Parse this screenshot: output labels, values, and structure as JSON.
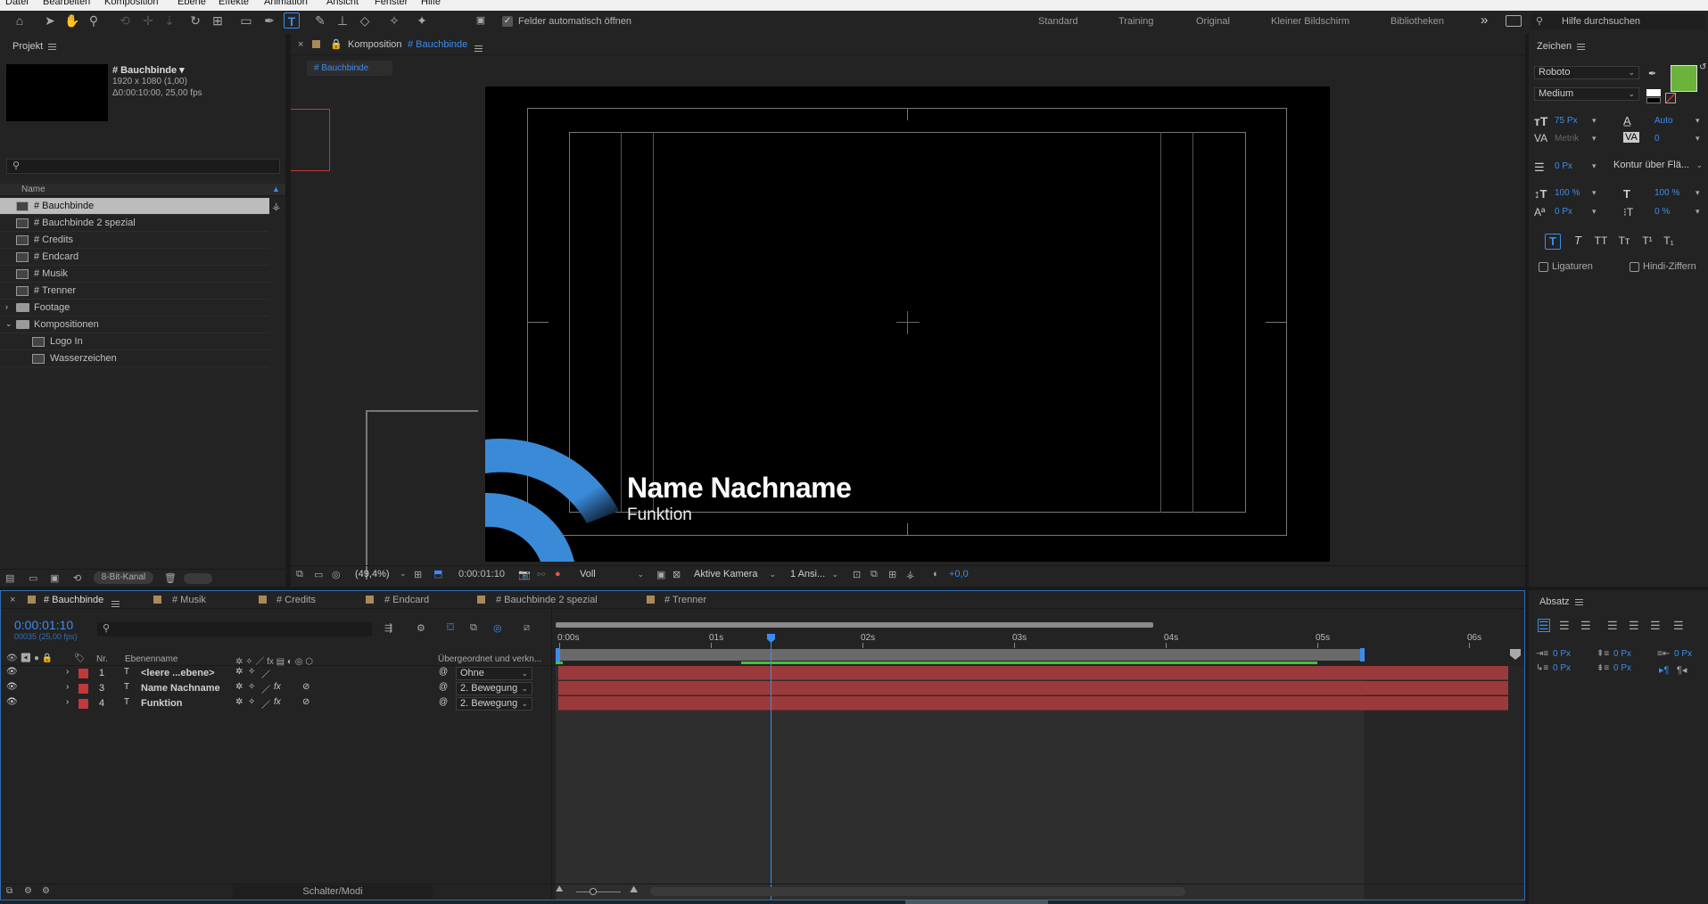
{
  "menu": [
    "Datei",
    "Bearbeiten",
    "Komposition",
    "Ebene",
    "Effekte",
    "Animation",
    "Ansicht",
    "Fenster",
    "Hilfe"
  ],
  "toolbar": {
    "auto_open_label": "Felder automatisch öffnen",
    "workspaces": [
      "Standard",
      "Training",
      "Original",
      "Kleiner Bildschirm",
      "Bibliotheken"
    ],
    "more": "»",
    "help_placeholder": "Hilfe durchsuchen"
  },
  "project": {
    "title": "Projekt",
    "selected_name": "# Bauchbinde ▾",
    "selected_info1": "1920 x 1080 (1,00)",
    "selected_info2": "Δ0:00:10:00, 25,00 fps",
    "column_name": "Name",
    "items": [
      {
        "label": "# Bauchbinde",
        "type": "comp",
        "indent": 0,
        "selected": true
      },
      {
        "label": "# Bauchbinde 2 spezial",
        "type": "comp",
        "indent": 0
      },
      {
        "label": "# Credits",
        "type": "comp",
        "indent": 0
      },
      {
        "label": "# Endcard",
        "type": "comp",
        "indent": 0
      },
      {
        "label": "# Musik",
        "type": "comp",
        "indent": 0
      },
      {
        "label": "# Trenner",
        "type": "comp",
        "indent": 0
      },
      {
        "label": "Footage",
        "type": "folder",
        "indent": 0,
        "expanded": false
      },
      {
        "label": "Kompositionen",
        "type": "folder",
        "indent": 0,
        "expanded": true
      },
      {
        "label": "Logo In",
        "type": "comp",
        "indent": 1
      },
      {
        "label": "Wasserzeichen",
        "type": "comp",
        "indent": 1
      }
    ],
    "bitdepth": "8-Bit-Kanal"
  },
  "composition": {
    "panel_label": "Komposition",
    "comp_name": "# Bauchbinde",
    "tab_label": "# Bauchbinde",
    "preview_name": "Name Nachname",
    "preview_function": "Funktion",
    "zoom": "(49,4%)",
    "timecode": "0:00:01:10",
    "resolution": "Voll",
    "camera": "Aktive Kamera",
    "views": "1 Ansi...",
    "exposure": "+0,0"
  },
  "character": {
    "title": "Zeichen",
    "font": "Roboto",
    "style": "Medium",
    "size": "75 Px",
    "leading": "Auto",
    "kerning": "Metrik",
    "tracking": "0",
    "stroke_width": "0 Px",
    "stroke_mode": "Kontur über Flä...",
    "vscale": "100 %",
    "hscale": "100 %",
    "baseline": "0 Px",
    "tsume": "0 %",
    "fill_color": "#6bb33a",
    "ligatures": "Ligaturen",
    "hindi": "Hindi-Ziffern",
    "style_buttons": [
      "T",
      "T",
      "TT",
      "Tт",
      "T¹",
      "T₁"
    ]
  },
  "paragraph": {
    "title": "Absatz",
    "indent_left": "0 Px",
    "space_before": "0 Px",
    "indent_right": "0 Px",
    "first_line": "0 Px",
    "space_after": "0 Px"
  },
  "timeline": {
    "tabs": [
      "# Bauchbinde",
      "# Musik",
      "# Credits",
      "# Endcard",
      "# Bauchbinde 2 spezial",
      "# Trenner"
    ],
    "timecode": "0:00:01:10",
    "frames": "00035 (25,00 fps)",
    "col_nr": "Nr.",
    "col_name": "Ebenenname",
    "col_parent": "Übergeordnet und verkn...",
    "layers": [
      {
        "nr": "1",
        "name": "<leere ...ebene>",
        "parent": "Ohne"
      },
      {
        "nr": "3",
        "name": "Name Nachname",
        "parent": "2. Bewegung"
      },
      {
        "nr": "4",
        "name": "Funktion",
        "parent": "2. Bewegung"
      }
    ],
    "ruler": [
      "0:00s",
      "01s",
      "02s",
      "03s",
      "04s",
      "05s",
      "06s"
    ],
    "switches_label": "Schalter/Modi"
  },
  "colors": {
    "accent": "#3b8cf0",
    "label_red": "#c0393b",
    "bar": "#9b3a3d",
    "green": "#3fc33f"
  }
}
